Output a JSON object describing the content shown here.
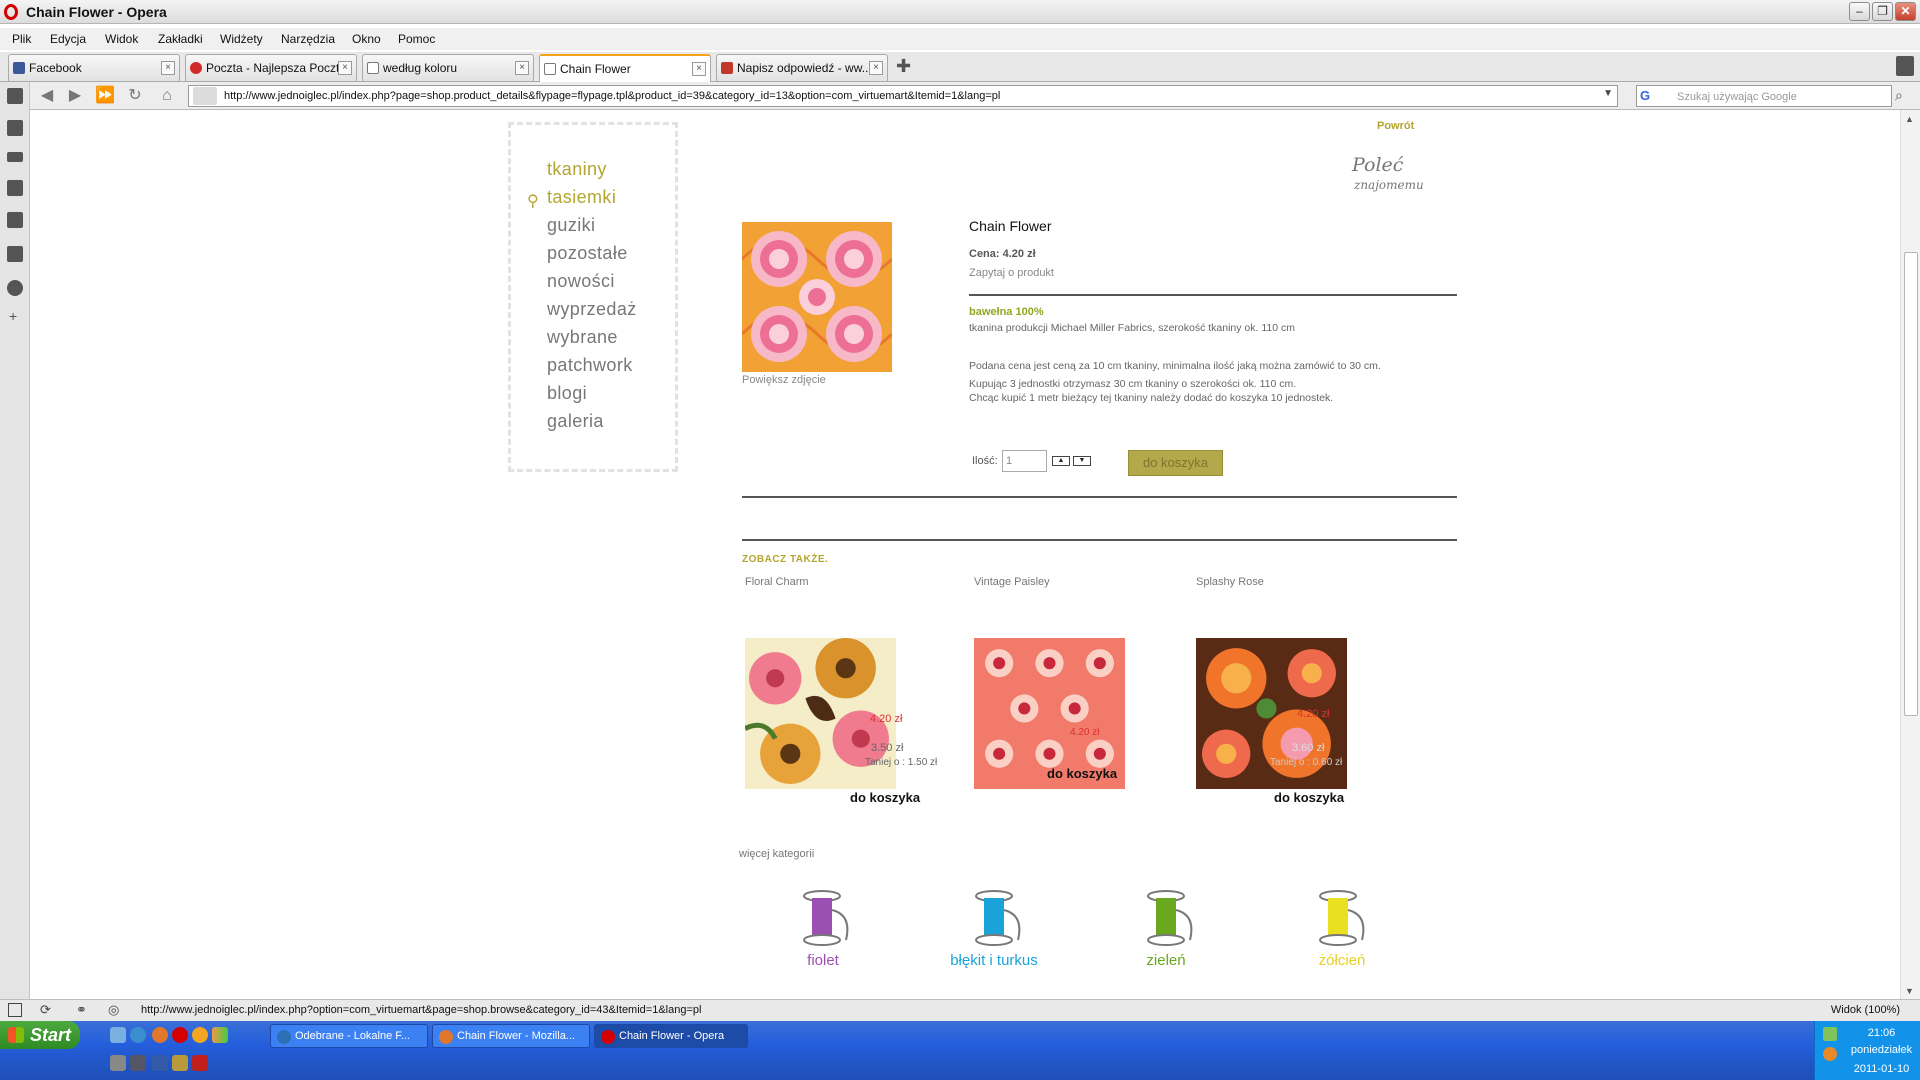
{
  "window": {
    "title": "Chain Flower - Opera"
  },
  "menu": [
    "Plik",
    "Edycja",
    "Widok",
    "Zakładki",
    "Widżety",
    "Narzędzia",
    "Okno",
    "Pomoc"
  ],
  "tabs": [
    {
      "label": "Facebook",
      "color": "#3b5998"
    },
    {
      "label": "Poczta - Najlepsza Poczt...",
      "color": "#d12a2a"
    },
    {
      "label": "według koloru",
      "color": "#777777"
    },
    {
      "label": "Chain Flower",
      "color": "#777777"
    },
    {
      "label": "Napisz odpowiedź - ww...",
      "color": "#c0392b"
    }
  ],
  "address": {
    "url": "http://www.jednoiglec.pl/index.php?page=shop.product_details&flypage=flypage.tpl&product_id=39&category_id=13&option=com_virtuemart&Itemid=1&lang=pl",
    "search_placeholder": "Szukaj używając Google"
  },
  "nav": [
    "tkaniny",
    "tasiemki",
    "guziki",
    "pozostałe",
    "nowości",
    "wyprzedaż",
    "wybrane",
    "patchwork",
    "blogi",
    "galeria"
  ],
  "header": {
    "back": "Powrót",
    "recommend": "Poleć",
    "recommend_sub": "znajomemu"
  },
  "product": {
    "title": "Chain Flower",
    "price": "Cena: 4.20 zł",
    "ask": "Zapytaj o produkt",
    "enlarge": "Powiększ zdjęcie",
    "material": "bawełna 100%",
    "desc1": "tkanina produkcji Michael Miller Fabrics, szerokość tkaniny ok. 110 cm",
    "desc2": "Podana cena jest ceną za 10 cm tkaniny, minimalna ilość jaką można zamówić to 30 cm.",
    "desc3": "Kupując 3 jednostki otrzymasz 30 cm tkaniny o szerokości ok. 110 cm.",
    "desc4": "Chcąc kupić 1 metr bieżący tej tkaniny należy dodać do koszyka 10 jednostek.",
    "qty_label": "Ilość:",
    "qty_value": "1",
    "add_to_cart": "do koszyka"
  },
  "related": {
    "heading": "ZOBACZ TAKŻE.",
    "items": [
      {
        "name": "Floral Charm",
        "cart": "do koszyka",
        "old_price": "4.20 zł",
        "new_price": "3.50 zł",
        "save": "Taniej o : 1.50 zł"
      },
      {
        "name": "Vintage Paisley",
        "cart": "do koszyka",
        "old_price": "4.20 zł",
        "new_price": "",
        "save": ""
      },
      {
        "name": "Splashy Rose",
        "cart": "do koszyka",
        "old_price": "4.20 zł",
        "new_price": "3.60 zł",
        "save": "Taniej o : 0.60 zł"
      }
    ],
    "more_categories": "więcej kategorii"
  },
  "color_categories": [
    {
      "label": "fiolet",
      "color": "#9b4fb0"
    },
    {
      "label": "błękit i turkus",
      "color": "#1aa3d8"
    },
    {
      "label": "zieleń",
      "color": "#6aa81f"
    },
    {
      "label": "żółcień",
      "color": "#e8e020"
    }
  ],
  "status": {
    "url": "http://www.jednoiglec.pl/index.php?option=com_virtuemart&page=shop.browse&category_id=43&Itemid=1&lang=pl",
    "zoom": "Widok (100%)"
  },
  "taskbar": {
    "start": "Start",
    "tasks": [
      "Odebrane - Lokalne F...",
      "Chain Flower - Mozilla...",
      "Chain Flower - Opera"
    ],
    "time": "21:06",
    "day": "poniedziałek",
    "date": "2011-01-10"
  }
}
